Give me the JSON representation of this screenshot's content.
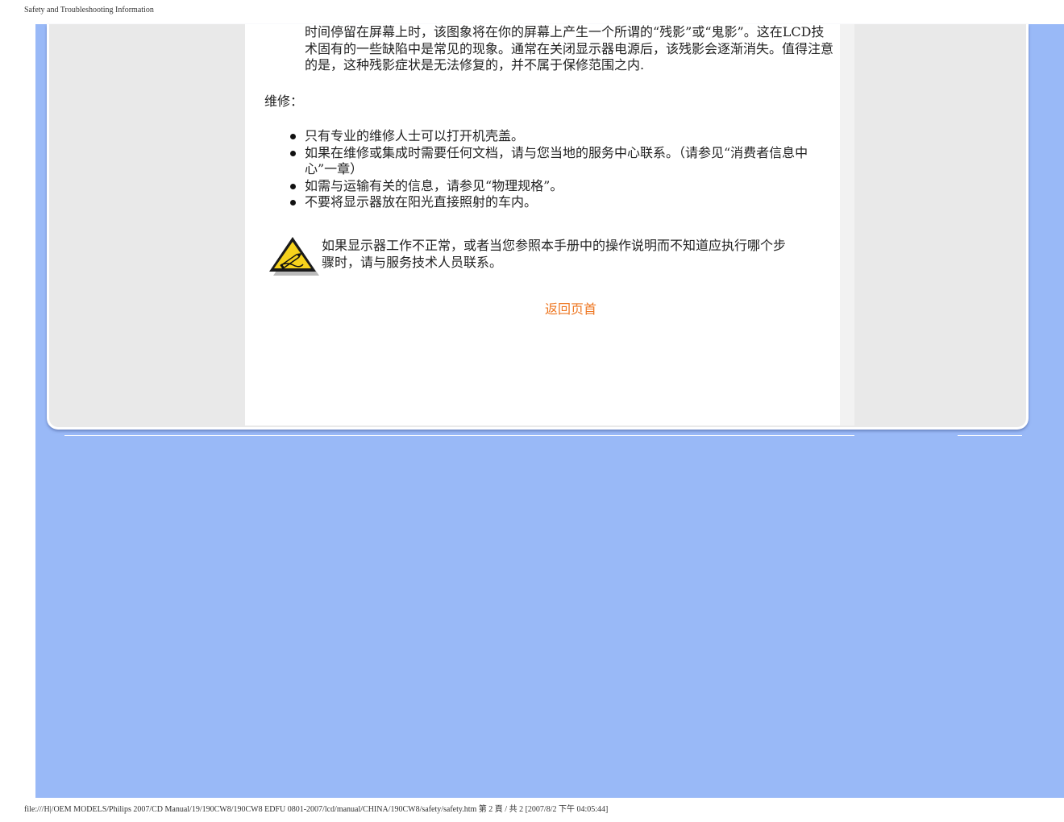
{
  "print_header": "Safety and Troubleshooting Information",
  "print_footer": "file:///H|/OEM MODELS/Philips 2007/CD Manual/19/190CW8/190CW8 EDFU 0801-2007/lcd/manual/CHINA/190CW8/safety/safety.htm 第 2 頁 / 共 2  [2007/8/2 下午 04:05:44]",
  "colors": {
    "page_background": "#99b9f7",
    "frame": "#e9e9e9",
    "link": "#ee7722"
  },
  "content": {
    "continued_paragraph": "时间停留在屏幕上时，该图象将在你的屏幕上产生一个所谓的“残影”或“鬼影”。这在LCD技术固有的一些缺陷中是常见的现象。通常在关闭显示器电源后，该残影会逐渐消失。值得注意的是，这种残影症状是无法修复的，并不属于保修范围之内.",
    "repair_heading": "维修：",
    "repair_items": [
      "只有专业的维修人士可以打开机壳盖。",
      "如果在维修或集成时需要任何文档，请与您当地的服务中心联系。（请参见“消费者信息中心”一章）",
      "如需与运输有关的信息，请参见“物理规格”。",
      "不要将显示器放在阳光直接照射的车内。"
    ],
    "warning_icon": "pencil-warning-icon",
    "warning_text": "如果显示器工作不正常，或者当您参照本手册中的操作说明而不知道应执行哪个步骤时，请与服务技术人员联系。",
    "back_to_top": "返回页首"
  }
}
